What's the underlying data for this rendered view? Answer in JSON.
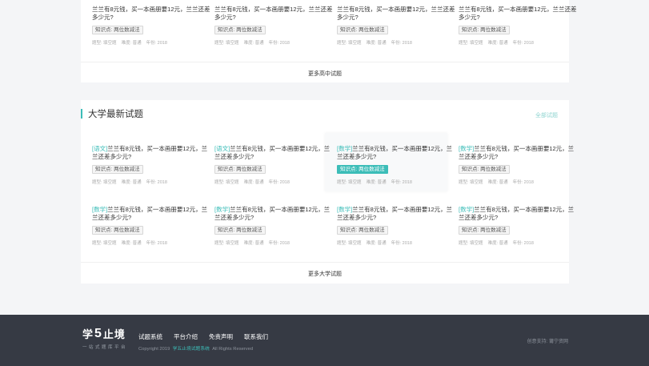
{
  "top_section": {
    "items": [
      {
        "q": "兰兰有8元钱，买一本画册要12元，兰兰还差多少元?",
        "tag": "知识点: 两位数减法",
        "meta_source": "题型: 填空题",
        "meta_difficulty": "难度: 普通",
        "meta_year": "年份: 2018"
      },
      {
        "q": "兰兰有8元钱，买一本画册要12元，兰兰还差多少元?",
        "tag": "知识点: 两位数减法",
        "meta_source": "题型: 填空题",
        "meta_difficulty": "难度: 普通",
        "meta_year": "年份: 2018"
      },
      {
        "q": "兰兰有8元钱，买一本画册要12元，兰兰还差多少元?",
        "tag": "知识点: 两位数减法",
        "meta_source": "题型: 填空题",
        "meta_difficulty": "难度: 普通",
        "meta_year": "年份: 2018"
      },
      {
        "q": "兰兰有8元钱，买一本画册要12元，兰兰还差多少元?",
        "tag": "知识点: 两位数减法",
        "meta_source": "题型: 填空题",
        "meta_difficulty": "难度: 普通",
        "meta_year": "年份: 2018"
      }
    ],
    "more_label": "更多高中试题"
  },
  "uni_section": {
    "title": "大学最新试题",
    "all_label": "全部试题",
    "items": [
      {
        "subject": "[语文]",
        "q": "兰兰有8元钱，买一本画册要12元，兰兰还差多少元?",
        "tag": "知识点: 两位数减法",
        "meta_source": "题型: 填空题",
        "meta_difficulty": "难度: 普通",
        "meta_year": "年份: 2018"
      },
      {
        "subject": "[语文]",
        "q": "兰兰有8元钱，买一本画册要12元，兰兰还差多少元?",
        "tag": "知识点: 两位数减法",
        "meta_source": "题型: 填空题",
        "meta_difficulty": "难度: 普通",
        "meta_year": "年份: 2018"
      },
      {
        "subject": "[数学]",
        "q": "兰兰有8元钱，买一本画册要12元，兰兰还差多少元?",
        "tag": "知识点: 两位数减法",
        "meta_source": "题型: 填空题",
        "meta_difficulty": "难度: 普通",
        "meta_year": "年份: 2018"
      },
      {
        "subject": "[数学]",
        "q": "兰兰有8元钱，买一本画册要12元，兰兰还差多少元?",
        "tag": "知识点: 两位数减法",
        "meta_source": "题型: 填空题",
        "meta_difficulty": "难度: 普通",
        "meta_year": "年份: 2018"
      },
      {
        "subject": "[数学]",
        "q": "兰兰有8元钱，买一本画册要12元，兰兰还差多少元?",
        "tag": "知识点: 两位数减法",
        "meta_source": "题型: 填空题",
        "meta_difficulty": "难度: 普通",
        "meta_year": "年份: 2018"
      },
      {
        "subject": "[数学]",
        "q": "兰兰有8元钱，买一本画册要12元，兰兰还差多少元?",
        "tag": "知识点: 两位数减法",
        "meta_source": "题型: 填空题",
        "meta_difficulty": "难度: 普通",
        "meta_year": "年份: 2018"
      },
      {
        "subject": "[数学]",
        "q": "兰兰有8元钱，买一本画册要12元，兰兰还差多少元?",
        "tag": "知识点: 两位数减法",
        "meta_source": "题型: 填空题",
        "meta_difficulty": "难度: 普通",
        "meta_year": "年份: 2018"
      },
      {
        "subject": "[数学]",
        "q": "兰兰有8元钱，买一本画册要12元，兰兰还差多少元?",
        "tag": "知识点: 两位数减法",
        "meta_source": "题型: 填空题",
        "meta_difficulty": "难度: 普通",
        "meta_year": "年份: 2018"
      }
    ],
    "more_label": "更多大学试题"
  },
  "footer": {
    "logo_a": "学",
    "logo_b": "5",
    "logo_c": "止境",
    "logo_sub": "一站式题库平台",
    "nav": [
      "试题系统",
      "平台介绍",
      "免责声明",
      "联系我们"
    ],
    "copy_a": "Copyright 2019",
    "copy_b": "学五止境试题系统",
    "copy_c": "All Rights Reserved",
    "support": "创意支持: 莆宁资网"
  },
  "colors": {
    "accent": "#3cbdb8",
    "footer_bg": "#363a44",
    "page_bg": "#f4f5f7"
  }
}
